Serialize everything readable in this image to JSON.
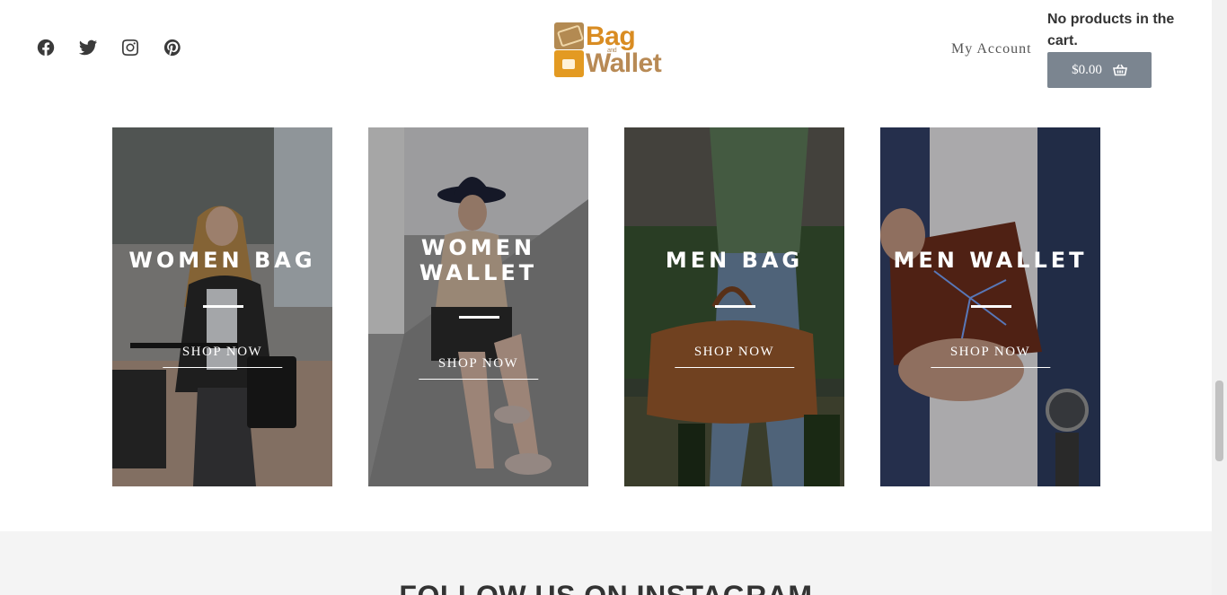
{
  "header": {
    "social": [
      {
        "icon": "facebook-icon"
      },
      {
        "icon": "twitter-icon"
      },
      {
        "icon": "instagram-icon"
      },
      {
        "icon": "pinterest-icon"
      }
    ],
    "logo": {
      "top": "Bag",
      "middle": "and",
      "bottom": "Wallet"
    },
    "my_account": "My Account",
    "cart": {
      "message": "No products in the cart.",
      "total": "$0.00",
      "icon": "basket-icon"
    }
  },
  "categories": [
    {
      "title": "WOMEN BAG",
      "cta": "SHOP NOW"
    },
    {
      "title": "WOMEN WALLET",
      "cta": "SHOP NOW"
    },
    {
      "title": "MEN BAG",
      "cta": "SHOP NOW"
    },
    {
      "title": "MEN WALLET",
      "cta": "SHOP NOW"
    }
  ],
  "instagram": {
    "heading": "FOLLOW US ON INSTAGRAM"
  },
  "colors": {
    "accent": "#d98c22",
    "cart_button": "#7b8590"
  }
}
